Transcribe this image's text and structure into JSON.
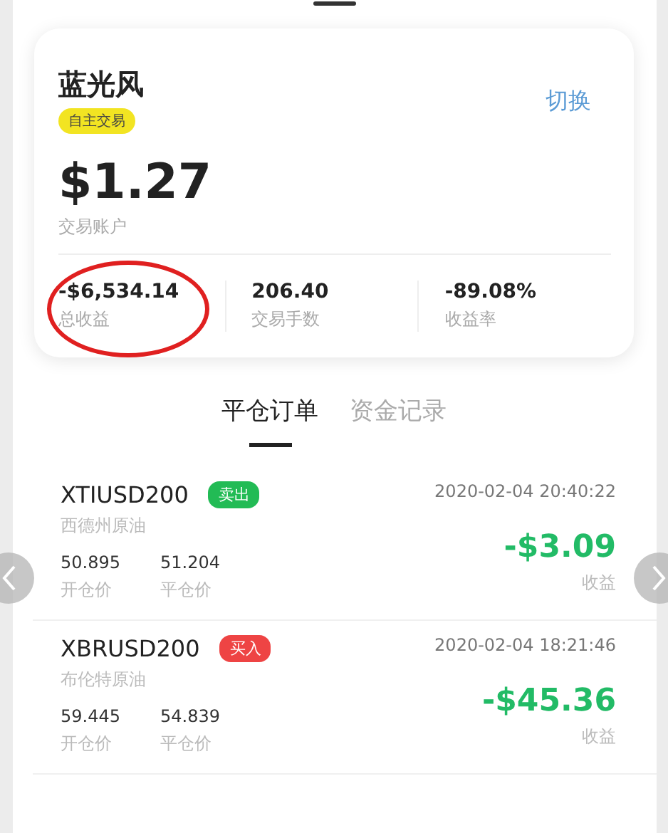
{
  "account": {
    "name": "蓝光风",
    "tag": "自主交易",
    "switch_label": "切换",
    "balance": "$1.27",
    "balance_label": "交易账户",
    "stats": [
      {
        "value": "-$6,534.14",
        "label": "总收益",
        "circled": true
      },
      {
        "value": "206.40",
        "label": "交易手数",
        "circled": false
      },
      {
        "value": "-89.08%",
        "label": "收益率",
        "circled": false
      }
    ]
  },
  "tabs": [
    {
      "label": "平仓订单",
      "selected": true
    },
    {
      "label": "资金记录",
      "selected": false
    }
  ],
  "orders": [
    {
      "symbol": "XTIUSD200",
      "side": {
        "kind": "sell",
        "label": "卖出"
      },
      "name": "西德州原油",
      "time": "2020-02-04 20:40:22",
      "open_price": "50.895",
      "open_label": "开仓价",
      "close_price": "51.204",
      "close_label": "平仓价",
      "profit": "-$3.09",
      "profit_label": "收益"
    },
    {
      "symbol": "XBRUSD200",
      "side": {
        "kind": "buy",
        "label": "买入"
      },
      "name": "布伦特原油",
      "time": "2020-02-04 18:21:46",
      "open_price": "59.445",
      "open_label": "开仓价",
      "close_price": "54.839",
      "close_label": "平仓价",
      "profit": "-$45.36",
      "profit_label": "收益"
    }
  ]
}
